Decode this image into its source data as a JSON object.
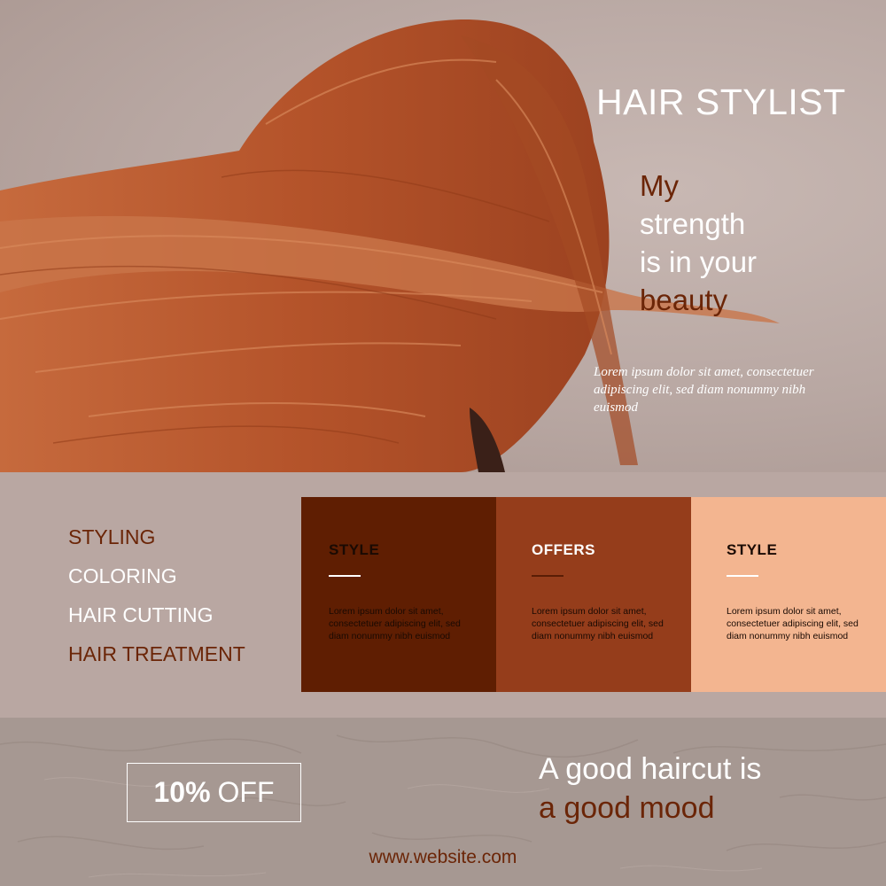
{
  "hero": {
    "title": "HAIR STYLIST",
    "tagline": [
      "My",
      "strength",
      "is in your",
      "beauty"
    ],
    "lorem": "Lorem ipsum dolor sit amet, consectetuer adipiscing elit, sed diam nonummy nibh euismod"
  },
  "services": {
    "items": [
      "STYLING",
      "COLORING",
      "HAIR CUTTING",
      "HAIR TREATMENT"
    ]
  },
  "cards": [
    {
      "title": "STYLE",
      "text": "Lorem ipsum dolor sit amet, consectetuer adipiscing elit, sed diam nonummy nibh euismod",
      "color": "#5f1e02"
    },
    {
      "title": "OFFERS",
      "text": "Lorem ipsum dolor sit amet, consectetuer adipiscing elit, sed diam nonummy nibh euismod",
      "color": "#953d1b"
    },
    {
      "title": "STYLE",
      "text": "Lorem ipsum dolor sit amet, consectetuer adipiscing elit, sed diam nonummy nibh euismod",
      "color": "#f3b590"
    }
  ],
  "offer": {
    "percent": "10%",
    "label": "OFF"
  },
  "slogan": [
    "A good haircut is",
    "a good mood"
  ],
  "footer": {
    "website": "www.website.com"
  },
  "colors": {
    "accent_dark": "#6b2507",
    "background": "#b9a7a2",
    "hair": "#b4532a"
  }
}
